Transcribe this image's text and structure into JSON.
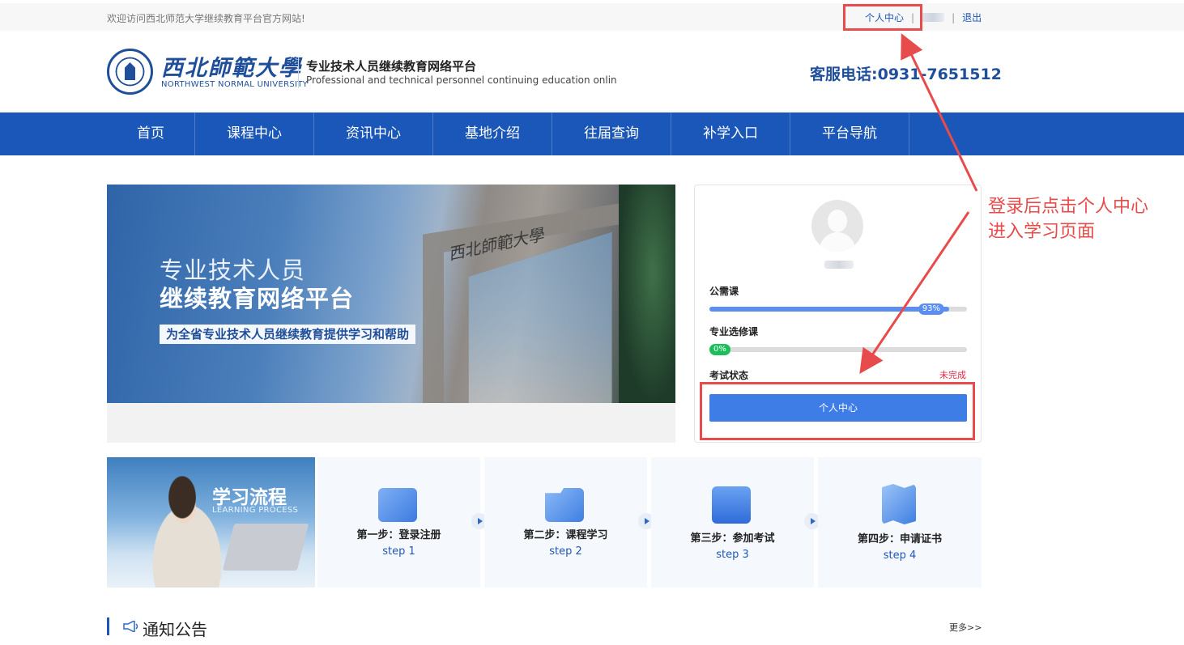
{
  "topbar": {
    "welcome": "欢迎访问西北师范大学继续教育平台官方网站!",
    "personal_center": "个人中心",
    "separator": "|",
    "logout": "退出"
  },
  "header": {
    "university_cn": "西北師範大學",
    "university_en": "NORTHWEST NORMAL UNIVERSITY",
    "platform_cn": "专业技术人员继续教育网络平台",
    "platform_en": "Professional and technical personnel continuing education onlin",
    "hotline": "客服电话:0931-7651512"
  },
  "nav": {
    "items": [
      "首页",
      "课程中心",
      "资讯中心",
      "基地介绍",
      "往届查询",
      "补学入口",
      "平台导航"
    ]
  },
  "banner": {
    "line1": "专业技术人员",
    "line2": "继续教育网络平台",
    "tagline": "为全省专业技术人员继续教育提供学习和帮助",
    "gate_sign": "西北師範大學"
  },
  "user_card": {
    "required_label": "公需课",
    "required_progress": 93,
    "required_pct_text": "93%",
    "elective_label": "专业选修课",
    "elective_progress": 0,
    "elective_pct_text": "0%",
    "exam_label": "考试状态",
    "exam_status": "未完成",
    "center_button": "个人中心",
    "colors": {
      "required_fill": "#5b8ef0",
      "elective_fill": "#1bbf5a",
      "status": "#e0294a",
      "button": "#3e7de6"
    }
  },
  "process": {
    "title": "学习流程",
    "subtitle": "LEARNING PROCESS",
    "steps": [
      {
        "title": "第一步：登录注册",
        "sub": "step 1",
        "icon": "image-icon"
      },
      {
        "title": "第二步：课程学习",
        "sub": "step 2",
        "icon": "folder-icon"
      },
      {
        "title": "第三步：参加考试",
        "sub": "step 3",
        "icon": "exam-icon"
      },
      {
        "title": "第四步：申请证书",
        "sub": "step 4",
        "icon": "map-certificate-icon"
      }
    ]
  },
  "notice": {
    "title": "通知公告",
    "more": "更多>>"
  },
  "annotation": {
    "line1": "登录后点击个人中心",
    "line2": "进入学习页面",
    "color": "#e84b4b"
  }
}
